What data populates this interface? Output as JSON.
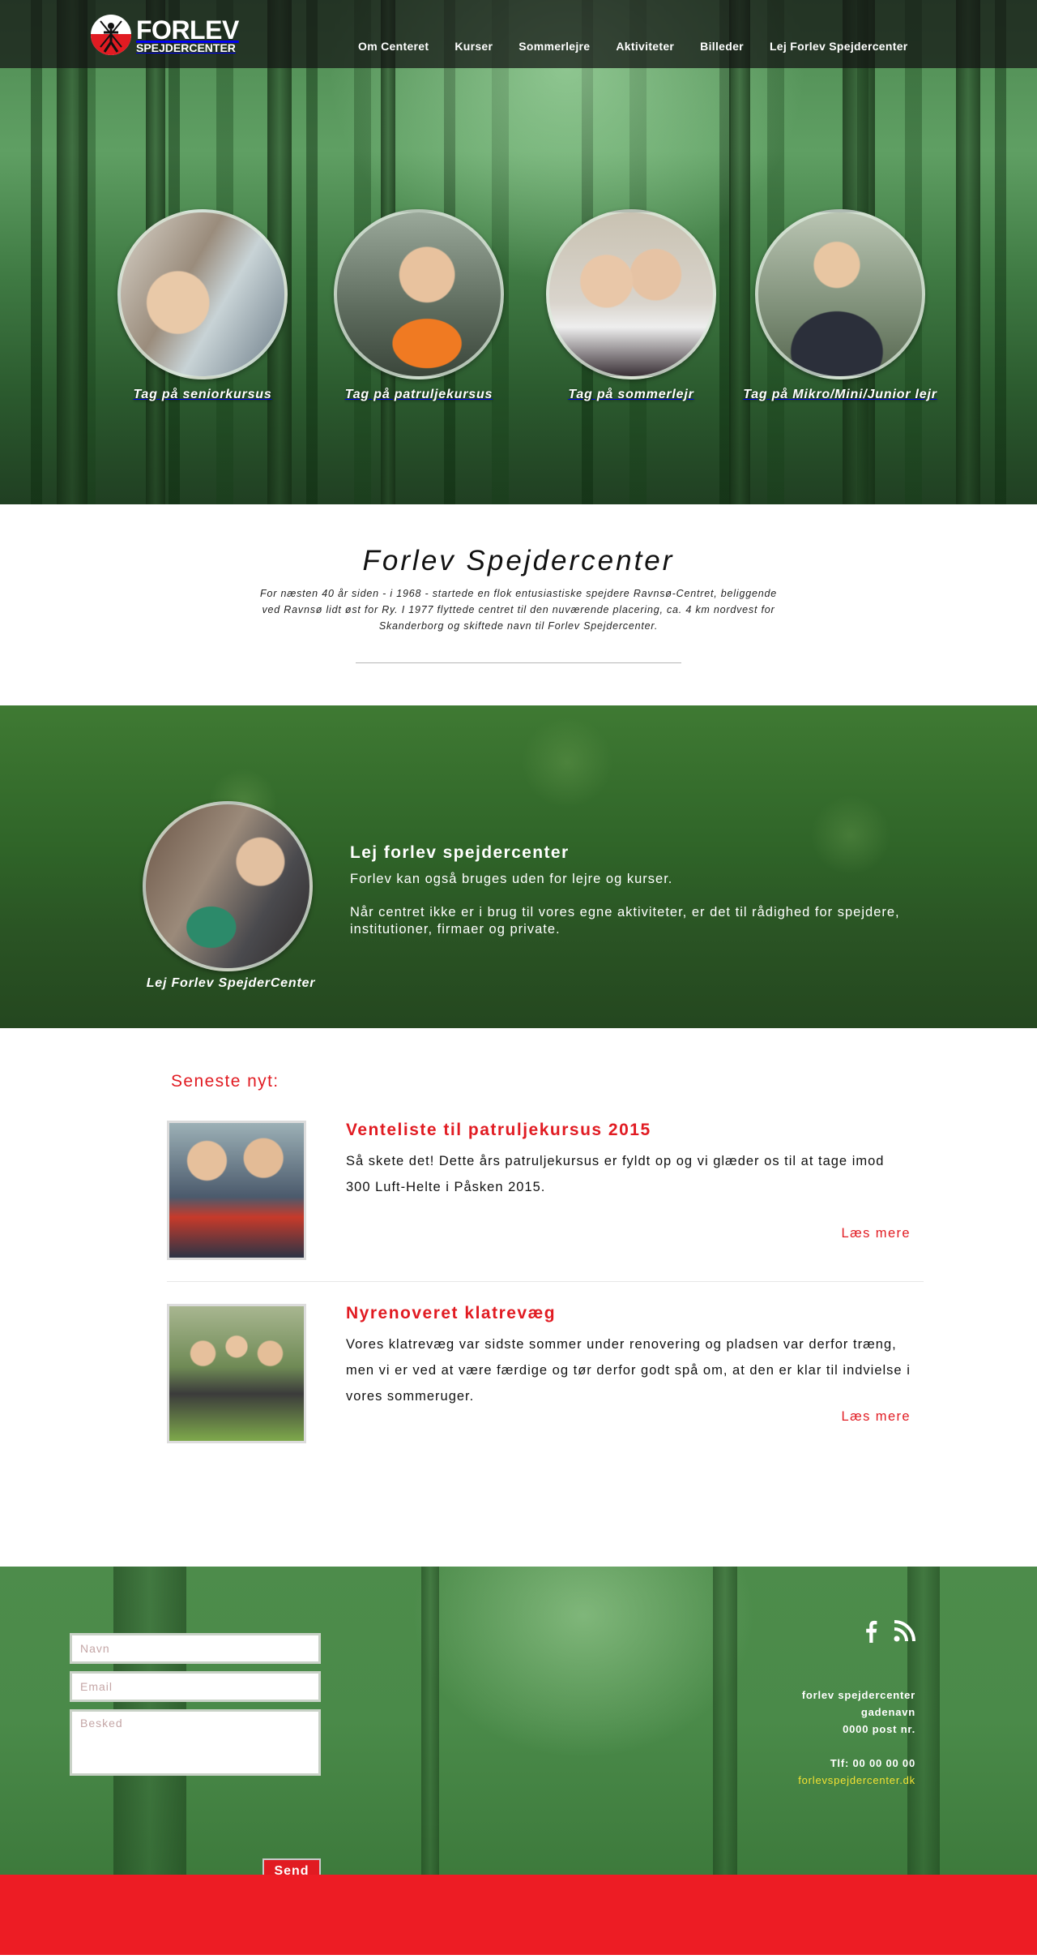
{
  "brand": {
    "name": "FORLEV",
    "subtitle": "SPEJDERCENTER",
    "accent_color": "#e11b22"
  },
  "nav": {
    "items": [
      {
        "label": "Om Centeret"
      },
      {
        "label": "Kurser"
      },
      {
        "label": "Sommerlejre"
      },
      {
        "label": "Aktiviteter"
      },
      {
        "label": "Billeder"
      },
      {
        "label": "Lej Forlev Spejdercenter"
      }
    ]
  },
  "hero": {
    "circles": [
      {
        "caption": "Tag på seniorkursus"
      },
      {
        "caption": "Tag på patruljekursus"
      },
      {
        "caption": "Tag på sommerlejr"
      },
      {
        "caption": "Tag på Mikro/Mini/Junior lejr"
      }
    ]
  },
  "intro": {
    "title": "Forlev Spejdercenter",
    "text": "For næsten 40 år siden - i 1968 - startede en flok entusiastiske spejdere Ravnsø-Centret, beliggende ved Ravnsø lidt øst for Ry. I 1977 flyttede centret til den nuværende placering, ca. 4 km nordvest for Skanderborg og skiftede navn til Forlev Spejdercenter."
  },
  "rent": {
    "caption": "Lej Forlev SpejderCenter",
    "title": "Lej forlev spejdercenter",
    "line1": "Forlev kan også bruges uden for lejre og kurser.",
    "line2": "Når centret ikke er i brug til vores egne aktiviteter, er det til rådighed for spejdere, institutioner, firmaer og private."
  },
  "news": {
    "heading": "Seneste nyt:",
    "items": [
      {
        "title": "Venteliste til patruljekursus 2015",
        "body": "Så skete det! Dette års patruljekursus er fyldt op og vi glæder os til at tage imod 300 Luft-Helte i Påsken 2015.",
        "more": "Læs mere"
      },
      {
        "title": "Nyrenoveret klatrevæg",
        "body": "Vores klatrevæg var sidste sommer under renovering og pladsen var derfor træng, men vi er ved at være færdige og tør derfor godt spå om, at den er klar til indvielse i vores sommeruger.",
        "more": "Læs mere"
      }
    ]
  },
  "footer": {
    "form": {
      "name_placeholder": "Navn",
      "email_placeholder": "Email",
      "message_placeholder": "Besked",
      "send_label": "Send"
    },
    "social": [
      "facebook-icon",
      "rss-icon"
    ],
    "contact": {
      "org": "forlev spejdercenter",
      "street": "gadenavn",
      "postal": "0000 post nr.",
      "phone": "Tlf: 00 00 00 00",
      "email": "forlevspejdercenter.dk"
    }
  }
}
